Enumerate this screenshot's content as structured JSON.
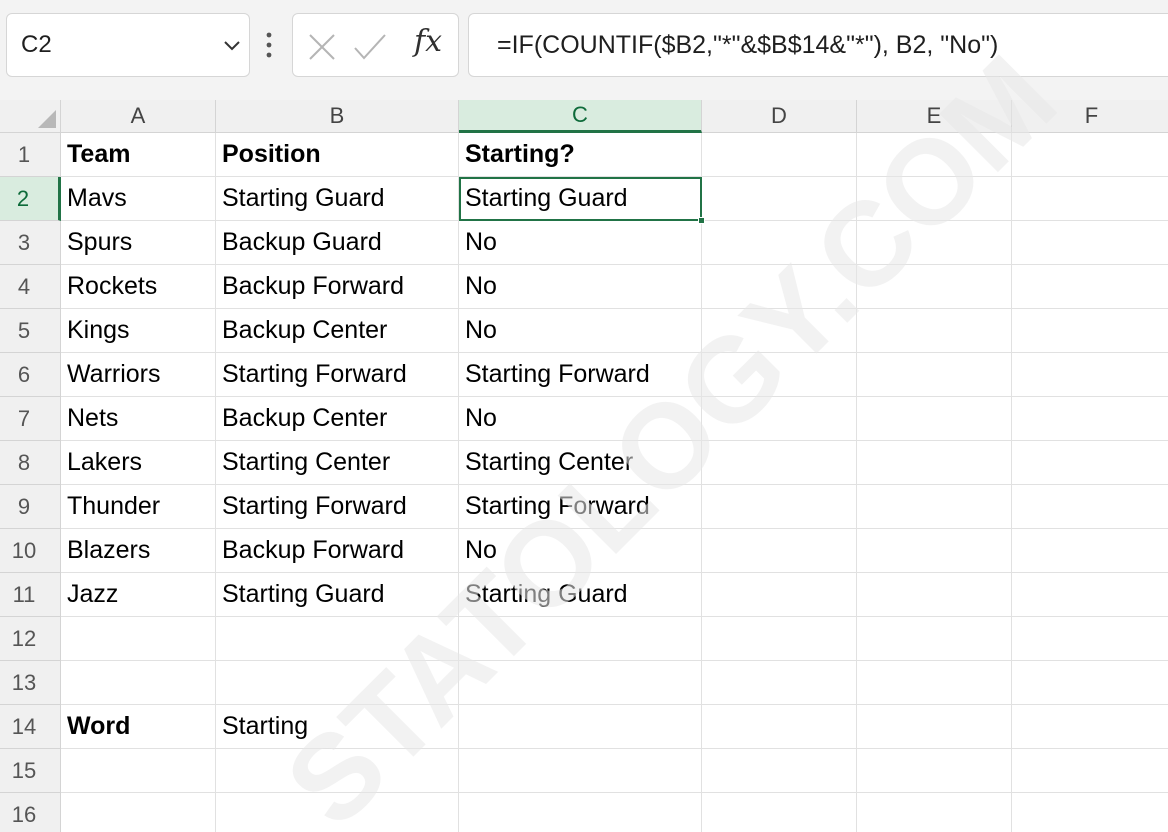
{
  "name_box": {
    "value": "C2"
  },
  "formula_bar": {
    "formula": "=IF(COUNTIF($B2,\"*\"&$B$14&\"*\"), B2, \"No\")"
  },
  "icons": {
    "name_box_dropdown": "chevron-down-icon",
    "more": "vertical-ellipsis-icon",
    "cancel": "close-icon",
    "enter": "check-icon",
    "function": "fx-icon"
  },
  "columns": [
    "A",
    "B",
    "C",
    "D",
    "E",
    "F"
  ],
  "rows": [
    "1",
    "2",
    "3",
    "4",
    "5",
    "6",
    "7",
    "8",
    "9",
    "10",
    "11",
    "12",
    "13",
    "14",
    "15",
    "16"
  ],
  "cells": {
    "r1": {
      "a": "Team",
      "b": "Position",
      "c": "Starting?"
    },
    "r2": {
      "a": "Mavs",
      "b": "Starting Guard",
      "c": "Starting Guard"
    },
    "r3": {
      "a": "Spurs",
      "b": "Backup Guard",
      "c": "No"
    },
    "r4": {
      "a": "Rockets",
      "b": "Backup Forward",
      "c": "No"
    },
    "r5": {
      "a": "Kings",
      "b": "Backup Center",
      "c": "No"
    },
    "r6": {
      "a": "Warriors",
      "b": "Starting Forward",
      "c": "Starting Forward"
    },
    "r7": {
      "a": "Nets",
      "b": "Backup Center",
      "c": "No"
    },
    "r8": {
      "a": "Lakers",
      "b": "Starting Center",
      "c": "Starting Center"
    },
    "r9": {
      "a": "Thunder",
      "b": "Starting Forward",
      "c": "Starting Forward"
    },
    "r10": {
      "a": "Blazers",
      "b": "Backup Forward",
      "c": "No"
    },
    "r11": {
      "a": "Jazz",
      "b": "Starting Guard",
      "c": "Starting Guard"
    },
    "r12": {
      "a": "",
      "b": "",
      "c": ""
    },
    "r13": {
      "a": "",
      "b": "",
      "c": ""
    },
    "r14": {
      "a": "Word",
      "b": "Starting",
      "c": ""
    },
    "r15": {
      "a": "",
      "b": "",
      "c": ""
    },
    "r16": {
      "a": "",
      "b": "",
      "c": ""
    }
  },
  "selection": {
    "active_cell": "C2",
    "accent_color": "#217346"
  },
  "watermark": {
    "text": "STATOLOGY.COM",
    "color": "#e8e8e8"
  }
}
